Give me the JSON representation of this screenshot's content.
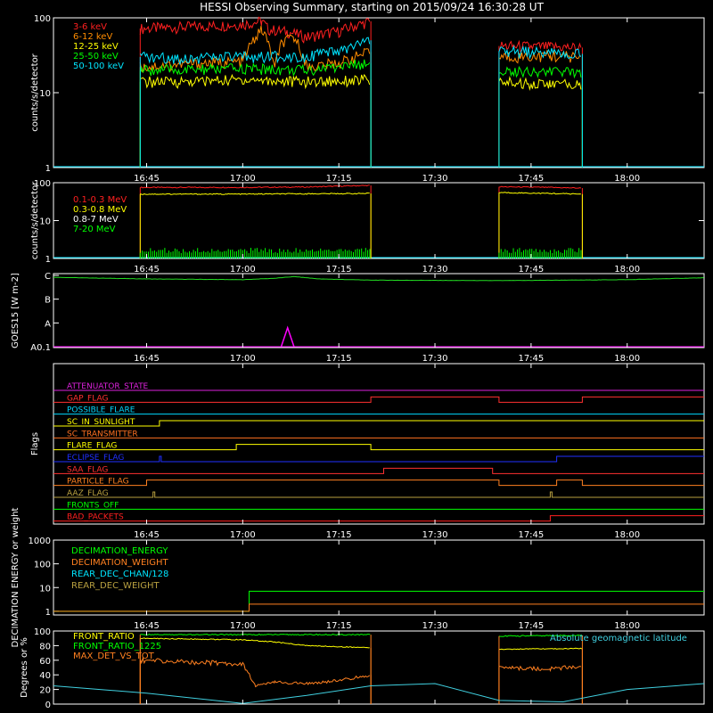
{
  "chart_data": {
    "title": "HESSI Observing Summary, starting on 2015/09/24 16:30:28 UT",
    "type": "line",
    "x_range": [
      "16:30:28",
      "18:12"
    ],
    "x_ticks": [
      "16:45",
      "17:00",
      "17:15",
      "17:30",
      "17:45",
      "18:00"
    ],
    "panels": [
      {
        "id": "low_energy",
        "ylabel": "counts/s/detector",
        "scale": "log",
        "ylim": [
          1,
          100
        ],
        "yticks": [
          "1",
          "10",
          "100"
        ],
        "legend": [
          "3-6 keV",
          "6-12 keV",
          "12-25 keV",
          "25-50 keV",
          "50-100 keV"
        ],
        "series": [
          {
            "name": "3-6 keV",
            "color": "#ff2020",
            "segments": [
              {
                "x": [
                  "16:44",
                  "16:50",
                  "16:55",
                  "17:00",
                  "17:03",
                  "17:04",
                  "17:07",
                  "17:10",
                  "17:15",
                  "17:20"
                ],
                "y": [
                  72,
                  75,
                  78,
                  82,
                  90,
                  70,
                  65,
                  55,
                  66,
                  90
                ]
              },
              {
                "x": [
                  "17:40",
                  "17:48",
                  "17:53"
                ],
                "y": [
                  42,
                  41,
                  40
                ]
              }
            ]
          },
          {
            "name": "6-12 keV",
            "color": "#ff8c00",
            "segments": [
              {
                "x": [
                  "16:44",
                  "16:50",
                  "17:00",
                  "17:01",
                  "17:03",
                  "17:05",
                  "17:06",
                  "17:08",
                  "17:10",
                  "17:15",
                  "17:20"
                ],
                "y": [
                  22,
                  24,
                  26,
                  40,
                  70,
                  20,
                  45,
                  55,
                  22,
                  25,
                  35
                ]
              },
              {
                "x": [
                  "17:40",
                  "17:48",
                  "17:53"
                ],
                "y": [
                  30,
                  31,
                  30
                ]
              }
            ]
          },
          {
            "name": "12-25 keV",
            "color": "#ffff00",
            "segments": [
              {
                "x": [
                  "16:44",
                  "16:50",
                  "17:00",
                  "17:10",
                  "17:20"
                ],
                "y": [
                  14,
                  14,
                  15,
                  14,
                  15
                ]
              },
              {
                "x": [
                  "17:40",
                  "17:48",
                  "17:53"
                ],
                "y": [
                  14,
                  13,
                  13
                ]
              }
            ]
          },
          {
            "name": "25-50 keV",
            "color": "#00ff00",
            "segments": [
              {
                "x": [
                  "16:44",
                  "16:50",
                  "17:00",
                  "17:10",
                  "17:20"
                ],
                "y": [
                  20,
                  20,
                  21,
                  20,
                  25
                ]
              },
              {
                "x": [
                  "17:40",
                  "17:48",
                  "17:53"
                ],
                "y": [
                  20,
                  19,
                  19
                ]
              }
            ]
          },
          {
            "name": "50-100 keV",
            "color": "#00e5ff",
            "segments": [
              {
                "x": [
                  "16:44",
                  "16:50",
                  "17:00",
                  "17:10",
                  "17:15",
                  "17:20"
                ],
                "y": [
                  30,
                  29,
                  30,
                  31,
                  35,
                  50
                ]
              },
              {
                "x": [
                  "17:40",
                  "17:48",
                  "17:53"
                ],
                "y": [
                  36,
                  34,
                  33
                ]
              }
            ]
          }
        ]
      },
      {
        "id": "high_energy",
        "ylabel": "counts/s/detector",
        "scale": "log",
        "ylim": [
          1,
          100
        ],
        "yticks": [
          "1",
          "10",
          "100"
        ],
        "legend": [
          "0.1-0.3 MeV",
          "0.3-0.8 MeV",
          "0.8-7 MeV",
          "7-20 MeV"
        ],
        "series": [
          {
            "name": "0.1-0.3 MeV",
            "color": "#ff2020",
            "segments": [
              {
                "x": [
                  "16:44",
                  "17:00",
                  "17:10",
                  "17:20"
                ],
                "y": [
                  75,
                  75,
                  77,
                  85
                ]
              },
              {
                "x": [
                  "17:40",
                  "17:48",
                  "17:53"
                ],
                "y": [
                  78,
                  75,
                  72
                ]
              }
            ]
          },
          {
            "name": "0.3-0.8 MeV",
            "color": "#ffff00",
            "segments": [
              {
                "x": [
                  "16:44",
                  "17:00",
                  "17:10",
                  "17:20"
                ],
                "y": [
                  50,
                  50,
                  51,
                  52
                ]
              },
              {
                "x": [
                  "17:40",
                  "17:48",
                  "17:53"
                ],
                "y": [
                  55,
                  52,
                  50
                ]
              }
            ]
          },
          {
            "name": "0.8-7 MeV",
            "color": "#ffffff",
            "segments": []
          },
          {
            "name": "7-20 MeV",
            "color": "#00ff00",
            "segments": [
              {
                "x": [
                  "16:44",
                  "17:20"
                ],
                "y": [
                  1.2,
                  1.2
                ]
              },
              {
                "x": [
                  "17:40",
                  "17:53"
                ],
                "y": [
                  1.2,
                  1.2
                ]
              }
            ]
          }
        ]
      },
      {
        "id": "goes",
        "ylabel": "GOES15 [W m-2]",
        "yticks": [
          "A0.1",
          "A",
          "B",
          "C"
        ],
        "series": [
          {
            "name": "GOES",
            "color": "#22dd22",
            "x": [
              "16:30:28",
              "16:45",
              "17:00",
              "17:05",
              "17:08",
              "17:12",
              "17:20",
              "17:40",
              "18:00",
              "18:12"
            ],
            "y": [
              2.92,
              2.85,
              2.82,
              2.88,
              2.95,
              2.85,
              2.8,
              2.78,
              2.82,
              2.9
            ]
          },
          {
            "name": "spike",
            "color": "#ff00ff",
            "x": [
              "17:06",
              "17:07",
              "17:08"
            ],
            "y": [
              0,
              0.8,
              0
            ]
          }
        ]
      },
      {
        "id": "flags",
        "ylabel": "Flags",
        "flags": [
          {
            "name": "ATTENUATOR_STATE",
            "color": "#dd22dd",
            "transitions": []
          },
          {
            "name": "GAP_FLAG",
            "color": "#ff3030",
            "transitions": [
              [
                "17:20",
                1
              ],
              [
                "17:40",
                0
              ],
              [
                "17:53",
                1
              ]
            ]
          },
          {
            "name": "POSSIBLE_FLARE",
            "color": "#00d8ff",
            "transitions": []
          },
          {
            "name": "SC_IN_SUNLIGHT",
            "color": "#ffff00",
            "transitions": [
              [
                "16:47",
                1
              ]
            ]
          },
          {
            "name": "SC_TRANSMITTER",
            "color": "#ff7020",
            "transitions": []
          },
          {
            "name": "FLARE_FLAG",
            "color": "#ffff00",
            "transitions": [
              [
                "16:59",
                1
              ],
              [
                "17:20",
                0
              ]
            ]
          },
          {
            "name": "ECLIPSE_FLAG",
            "color": "#2030ff",
            "transitions": [
              [
                "16:47",
                0
              ],
              [
                "17:49",
                1
              ]
            ]
          },
          {
            "name": "SAA_FLAG",
            "color": "#ff3030",
            "transitions": [
              [
                "17:22",
                1
              ],
              [
                "17:39",
                0
              ]
            ]
          },
          {
            "name": "PARTICLE_FLAG",
            "color": "#ff8020",
            "transitions": [
              [
                "16:45",
                1
              ],
              [
                "17:40",
                0
              ],
              [
                "17:49",
                1
              ],
              [
                "17:53",
                0
              ]
            ]
          },
          {
            "name": "AAZ_FLAG",
            "color": "#b8a040",
            "transitions": [
              [
                "16:46",
                0
              ],
              [
                "17:48",
                0
              ]
            ]
          },
          {
            "name": "FRONTS_OFF",
            "color": "#00ff00",
            "transitions": []
          },
          {
            "name": "BAD_PACKETS",
            "color": "#ff2020",
            "transitions": [
              [
                "17:48",
                1
              ]
            ]
          }
        ]
      },
      {
        "id": "decimation",
        "ylabel": "DECIMATION ENERGY or weight",
        "scale": "log",
        "ylim": [
          0.7,
          1000
        ],
        "yticks": [
          "1",
          "10",
          "100",
          "1000"
        ],
        "legend": [
          "DECIMATION_ENERGY",
          "DECIMATION_WEIGHT",
          "REAR_DEC_CHAN/128",
          "REAR_DEC_WEIGHT"
        ],
        "series": [
          {
            "name": "DECIMATION_ENERGY",
            "color": "#00ff00",
            "x": [
              "16:30:28",
              "17:01",
              "17:01",
              "18:12"
            ],
            "y": [
              1,
              1,
              7,
              7
            ]
          },
          {
            "name": "DECIMATION_WEIGHT",
            "color": "#ff8020",
            "x": [
              "16:30:28",
              "17:01",
              "17:01",
              "18:12"
            ],
            "y": [
              1,
              1,
              2,
              2
            ]
          },
          {
            "name": "REAR_DEC_CHAN/128",
            "color": "#00e5ff",
            "x": [],
            "y": []
          },
          {
            "name": "REAR_DEC_WEIGHT",
            "color": "#b8a040",
            "x": [],
            "y": []
          }
        ]
      },
      {
        "id": "ratios",
        "ylabel": "Degrees or %",
        "ylim": [
          0,
          100
        ],
        "yticks": [
          "0",
          "20",
          "40",
          "60",
          "80",
          "100"
        ],
        "legend": [
          "FRONT_RATIO",
          "FRONT_RATIO_1225",
          "MAX_DET_VS_TOT"
        ],
        "annotation": "Absolute geomagnetic latitude",
        "series": [
          {
            "name": "FRONT_RATIO",
            "color": "#ffff00",
            "segments": [
              {
                "x": [
                  "16:44",
                  "17:00",
                  "17:05",
                  "17:10",
                  "17:20"
                ],
                "y": [
                  90,
                  88,
                  85,
                  80,
                  77
                ]
              },
              {
                "x": [
                  "17:40",
                  "17:53"
                ],
                "y": [
                  75,
                  76
                ]
              }
            ]
          },
          {
            "name": "FRONT_RATIO_1225",
            "color": "#00ff00",
            "segments": [
              {
                "x": [
                  "16:44",
                  "17:20"
                ],
                "y": [
                  95,
                  95
                ]
              },
              {
                "x": [
                  "17:40",
                  "17:53"
                ],
                "y": [
                  93,
                  94
                ]
              }
            ]
          },
          {
            "name": "MAX_DET_VS_TOT",
            "color": "#ff8020",
            "segments": [
              {
                "x": [
                  "16:44",
                  "16:50",
                  "17:00",
                  "17:02",
                  "17:05",
                  "17:10",
                  "17:15",
                  "17:20"
                ],
                "y": [
                  60,
                  58,
                  55,
                  25,
                  30,
                  28,
                  32,
                  40
                ]
              },
              {
                "x": [
                  "17:40",
                  "17:48",
                  "17:53"
                ],
                "y": [
                  50,
                  48,
                  52
                ]
              }
            ]
          },
          {
            "name": "Absolute geomagnetic latitude",
            "color": "#40d0e0",
            "x": [
              "16:30:28",
              "16:45",
              "17:00",
              "17:10",
              "17:20",
              "17:30",
              "17:40",
              "17:50",
              "18:00",
              "18:12"
            ],
            "y": [
              25,
              15,
              1,
              12,
              25,
              28,
              5,
              3,
              20,
              28
            ]
          }
        ]
      }
    ]
  }
}
